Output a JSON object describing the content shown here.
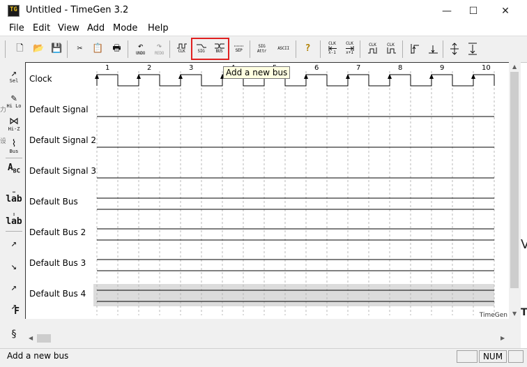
{
  "window": {
    "title": "Untitled - TimeGen 3.2",
    "app_icon_text": "TG"
  },
  "window_controls": {
    "minimize": "—",
    "maximize": "☐",
    "close": "✕"
  },
  "menu": [
    "File",
    "Edit",
    "View",
    "Add",
    "Mode",
    "Help"
  ],
  "toolbar": {
    "new_glyph": "🗋",
    "open_glyph": "📂",
    "save_glyph": "💾",
    "cut_glyph": "✂",
    "copy_glyph": "📋",
    "print_glyph": "🖶",
    "undo_glyph": "↶",
    "undo_label": "UNDO",
    "redo_glyph": "↷",
    "redo_label": "REDO",
    "clk_label": "CLK",
    "sig_label": "SIG",
    "bus_label": "BUS",
    "sep_label": "SEP",
    "sig_attr_label_1": "SIG",
    "sig_attr_label_2": "Attr",
    "ascii_label": "ASCII",
    "help_glyph": "?",
    "clk_left_label": "CLK",
    "clk_left_sub": "x-1",
    "clk_right_label": "CLK",
    "clk_right_sub": "x+1",
    "clk_a_label": "CLK",
    "clk_b_label": "CLK"
  },
  "tooltip": "Add a new bus",
  "left_tools": {
    "select_label": "Sel",
    "hilo_label": "Hi Lo",
    "hiz_label": "Hi-Z",
    "bus_label": "Bus",
    "abc_glyph": "A",
    "abc_sub": "B",
    "abc_sub2": "C",
    "lab1_label": "lab",
    "lab2_label": "lab",
    "f_label": "F"
  },
  "signals": [
    {
      "name": "Clock",
      "type": "clock"
    },
    {
      "name": "Default Signal",
      "type": "signal"
    },
    {
      "name": "Default Signal 2",
      "type": "signal"
    },
    {
      "name": "Default Signal 3",
      "type": "signal"
    },
    {
      "name": "Default Bus",
      "type": "bus"
    },
    {
      "name": "Default Bus 2",
      "type": "bus"
    },
    {
      "name": "Default Bus 3",
      "type": "bus"
    },
    {
      "name": "Default Bus 4",
      "type": "bus",
      "selected": true
    }
  ],
  "cycle_numbers": [
    "1",
    "2",
    "3",
    "4",
    "5",
    "6",
    "7",
    "8",
    "9",
    "10"
  ],
  "watermark": "TimeGen",
  "status": {
    "text": "Add a new bus",
    "num": "NUM"
  },
  "background_glimpses": {
    "right_char": "V",
    "right_char2": "T"
  },
  "colors": {
    "selection_row": "#dcdcdc",
    "highlight_box": "#e02020",
    "tooltip_bg": "#ffffe1"
  }
}
